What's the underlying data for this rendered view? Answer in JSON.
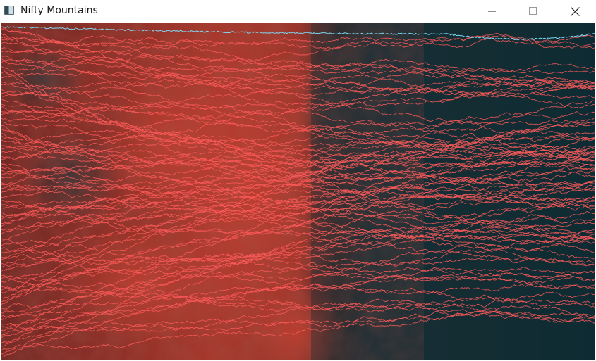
{
  "window": {
    "title": "Nifty Mountains",
    "app_icon": "window-app-icon",
    "controls": {
      "minimize_icon": "minimize-icon",
      "maximize_icon": "maximize-icon",
      "close_icon": "close-icon"
    }
  },
  "canvas": {
    "content": "elevation-map-with-greedy-paths",
    "colors": {
      "elevation_high": "#c9402f",
      "elevation_low": "#0e2f36",
      "path": "#ff5a5a",
      "best_path": "#7fd6f0"
    }
  }
}
